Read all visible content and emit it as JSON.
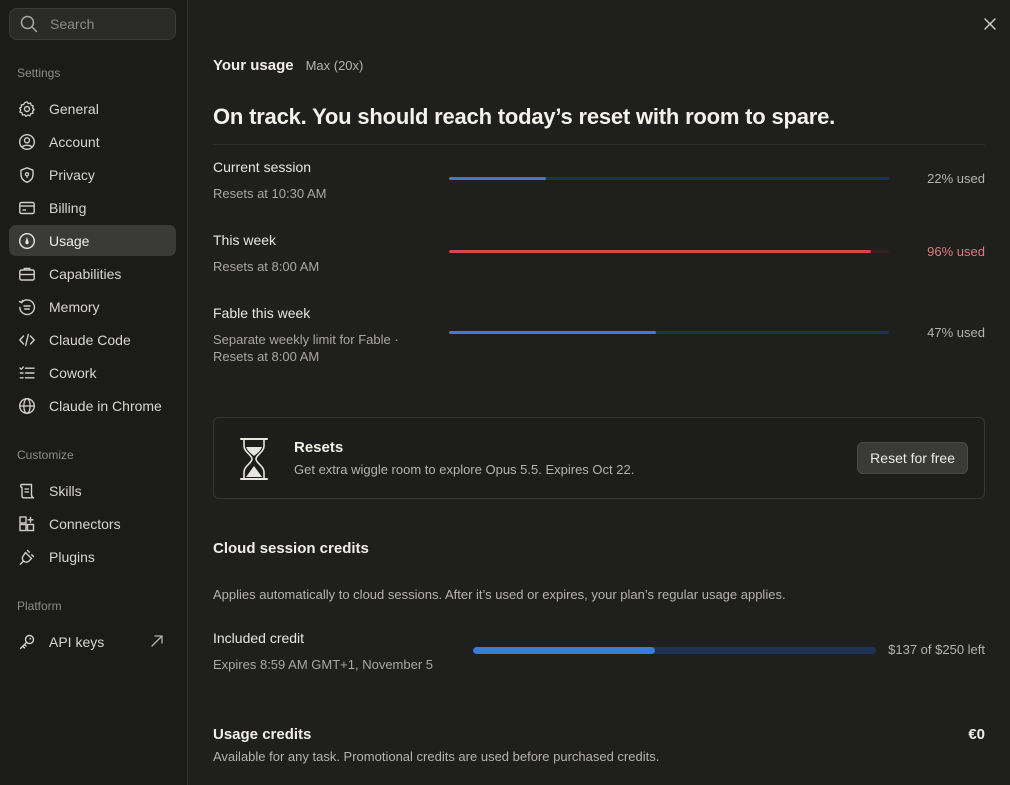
{
  "sidebar": {
    "search_placeholder": "Search",
    "sections": {
      "settings": "Settings",
      "customize": "Customize",
      "platform": "Platform"
    },
    "settings_items": [
      {
        "label": "General",
        "icon": "gear-icon"
      },
      {
        "label": "Account",
        "icon": "user-circle-icon"
      },
      {
        "label": "Privacy",
        "icon": "shield-icon"
      },
      {
        "label": "Billing",
        "icon": "credit-card-icon"
      },
      {
        "label": "Usage",
        "icon": "gauge-icon",
        "active": true
      },
      {
        "label": "Capabilities",
        "icon": "briefcase-icon"
      },
      {
        "label": "Memory",
        "icon": "memory-icon"
      },
      {
        "label": "Claude Code",
        "icon": "code-icon"
      },
      {
        "label": "Cowork",
        "icon": "checklist-icon"
      },
      {
        "label": "Claude in Chrome",
        "icon": "globe-icon"
      }
    ],
    "customize_items": [
      {
        "label": "Skills",
        "icon": "scroll-icon"
      },
      {
        "label": "Connectors",
        "icon": "grid-plus-icon"
      },
      {
        "label": "Plugins",
        "icon": "plug-icon"
      }
    ],
    "platform_items": [
      {
        "label": "API keys",
        "icon": "key-icon",
        "external": true
      }
    ]
  },
  "main": {
    "title": "Your usage",
    "plan": "Max (20x)",
    "headline": "On track. You should reach today’s reset with room to spare.",
    "limits": [
      {
        "label": "Current session",
        "sub": "Resets at 10:30 AM",
        "used_fraction": 0.22,
        "pct_text": "22% used",
        "status": "normal"
      },
      {
        "label": "This week",
        "sub": "Resets at 8:00 AM",
        "used_fraction": 0.96,
        "pct_text": "96% used",
        "status": "warning"
      },
      {
        "label": "Fable this week",
        "sub": "Separate weekly limit for Fable ·",
        "sub2": "Resets at 8:00 AM",
        "used_fraction": 0.47,
        "pct_text": "47% used",
        "status": "normal"
      }
    ],
    "resets_card": {
      "title": "Resets",
      "subtitle": "Get extra wiggle room to explore Opus 5.5. Expires Oct 22.",
      "button": "Reset for free",
      "icon": "hourglass-icon"
    },
    "cloud": {
      "title": "Cloud session credits",
      "description": "Applies automatically to cloud sessions. After it’s used or expires, your plan’s regular usage applies.",
      "credit_label": "Included credit",
      "credit_sub": "Expires 8:59 AM GMT+1, November 5",
      "remaining_fraction": 0.452,
      "credit_text": "$137 of $250 left"
    },
    "usage_credits": {
      "title": "Usage credits",
      "amount": "€0",
      "description": "Available for any task. Promotional credits are used before purchased credits."
    }
  },
  "colors": {
    "accent_blue": "#3b7bd8",
    "warning_red": "#d8454a",
    "background": "#1f1f1e",
    "sidebar_bg": "#1b1b1a"
  }
}
